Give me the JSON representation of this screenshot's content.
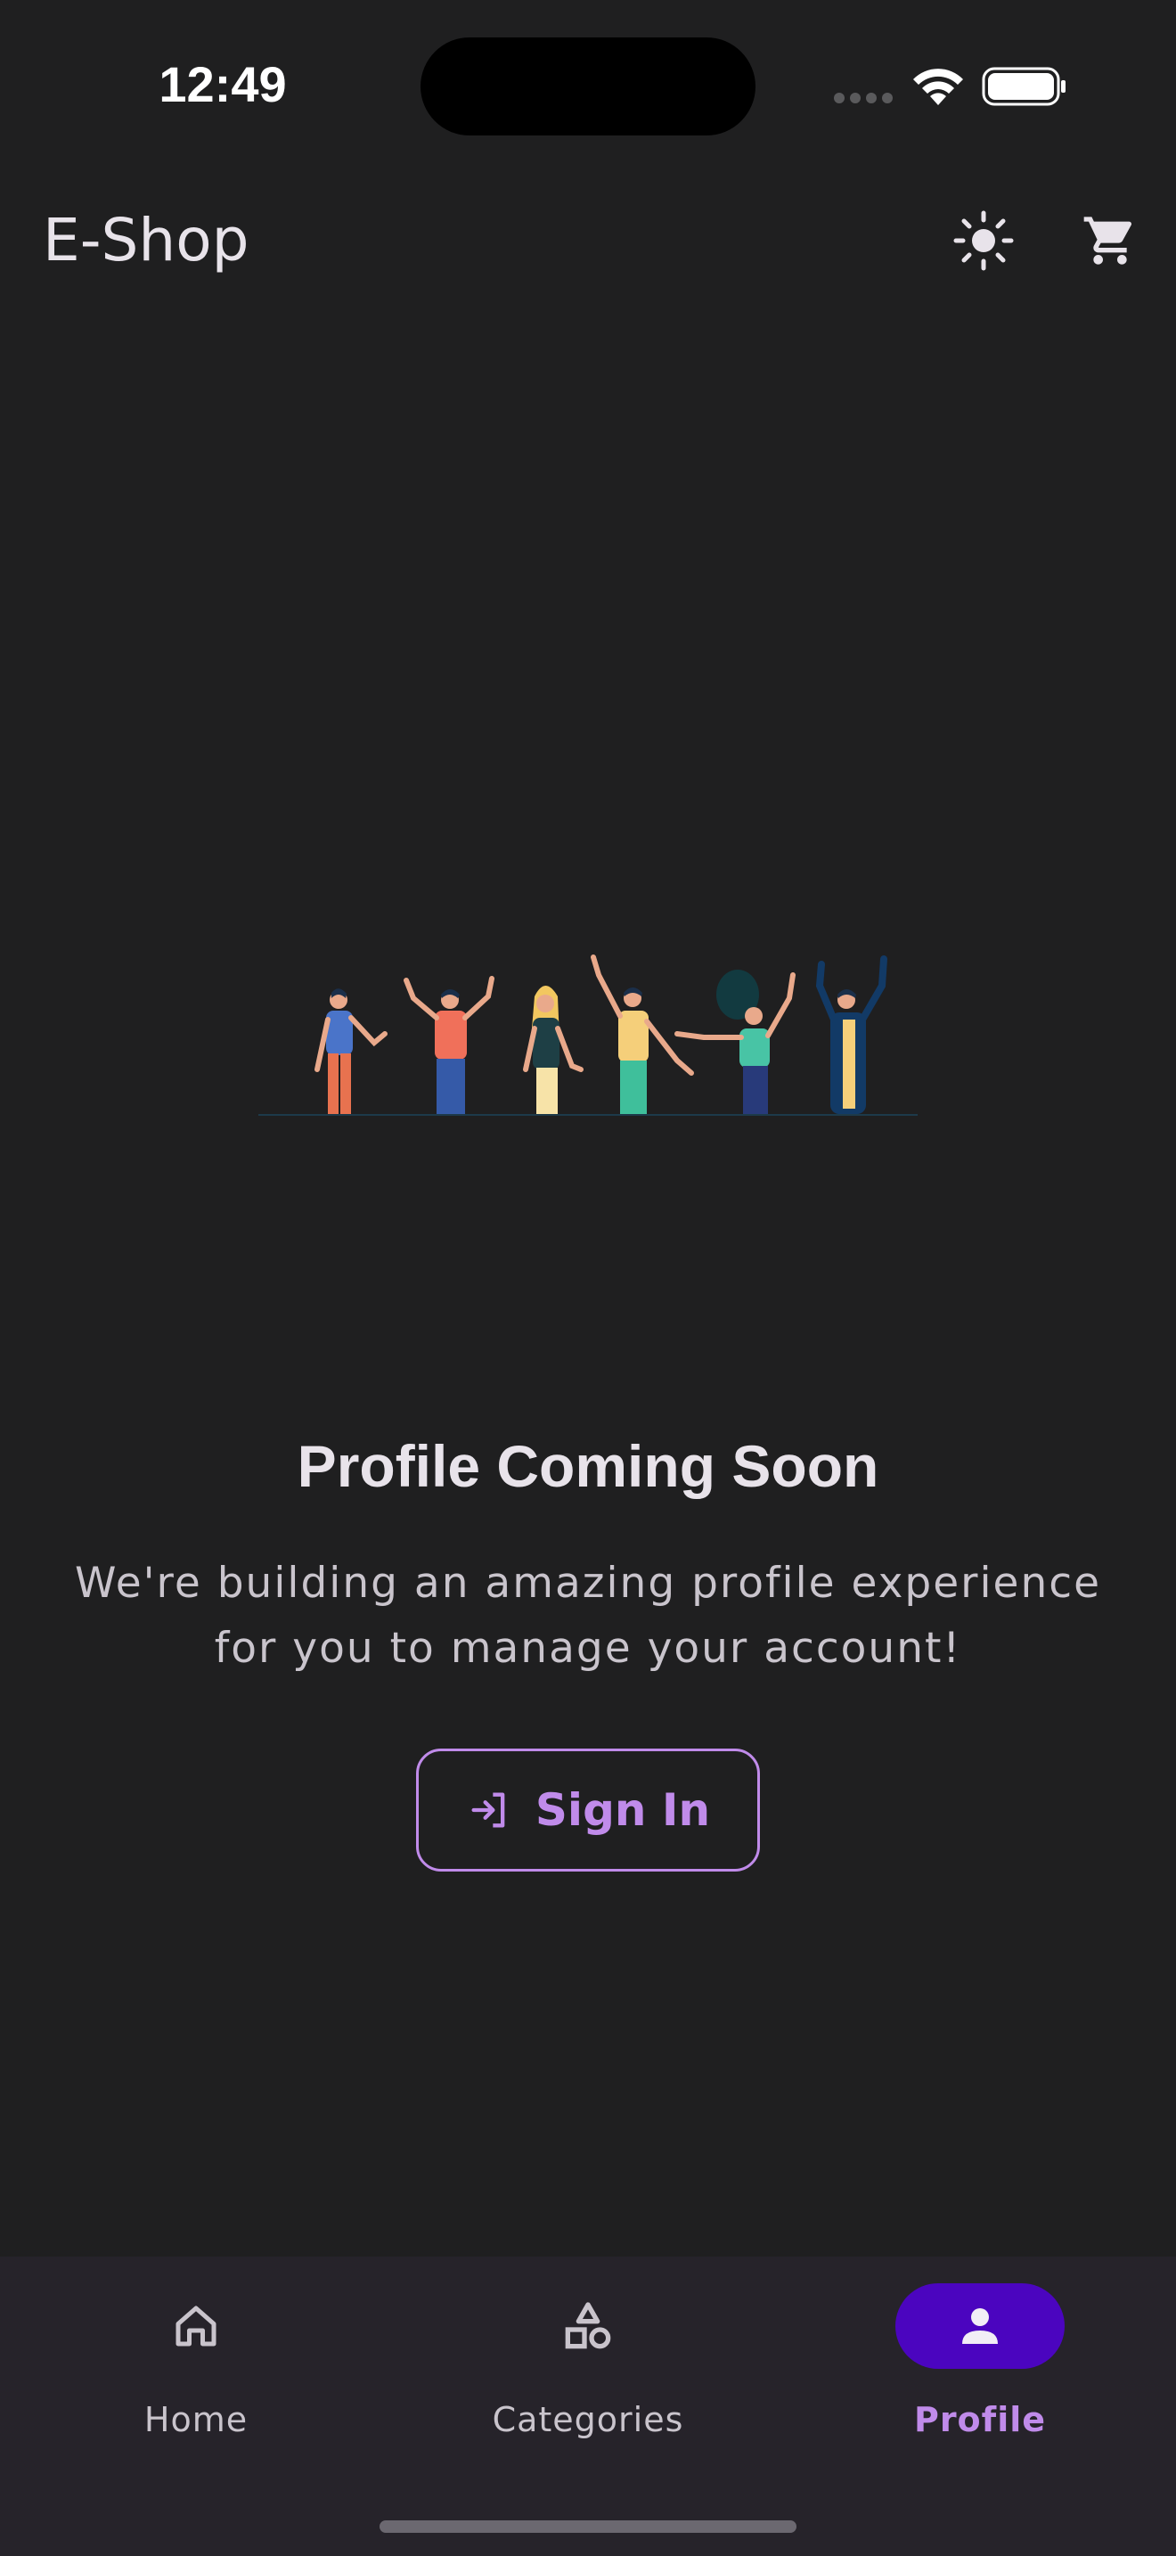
{
  "status_bar": {
    "time": "12:49"
  },
  "app_bar": {
    "title": "E-Shop",
    "actions": [
      {
        "icon": "sun-icon",
        "purpose": "theme-toggle"
      },
      {
        "icon": "shopping-cart-icon",
        "purpose": "cart"
      }
    ]
  },
  "illustration": {
    "icon": "people-celebrating-illustration"
  },
  "content": {
    "title": "Profile Coming Soon",
    "subtitle_line1": "We're building an amazing profile experience",
    "subtitle_line2": "for you to manage your account!",
    "sign_in_label": "Sign In",
    "sign_in_icon": "login-icon"
  },
  "bottom_nav": {
    "items": [
      {
        "label": "Home",
        "icon": "home-icon",
        "selected": false
      },
      {
        "label": "Categories",
        "icon": "categories-icon",
        "selected": false
      },
      {
        "label": "Profile",
        "icon": "person-icon",
        "selected": true
      }
    ]
  },
  "colors": {
    "background": "#1f1f20",
    "accent": "#c08bea",
    "nav_selected_pill": "#4b05bf",
    "nav_background": "#26232a"
  }
}
